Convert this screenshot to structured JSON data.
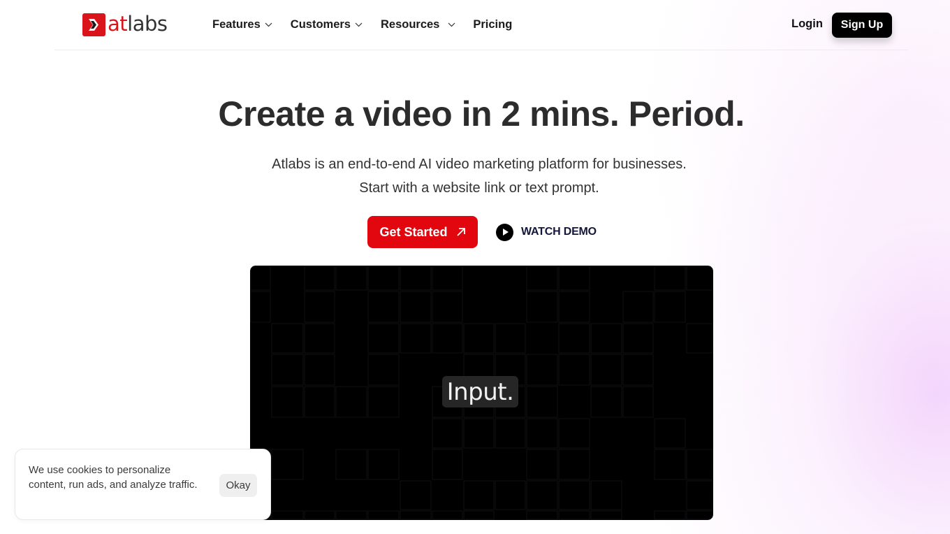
{
  "header": {
    "logo": {
      "accent_part": "at",
      "rest_part": "labs",
      "brand_color": "#d9141b"
    },
    "nav": [
      {
        "label": "Features",
        "has_dropdown": true
      },
      {
        "label": "Customers",
        "has_dropdown": true
      },
      {
        "label": "Resources",
        "has_dropdown": true
      },
      {
        "label": "Pricing",
        "has_dropdown": false
      }
    ],
    "login_label": "Login",
    "signup_label": "Sign Up"
  },
  "hero": {
    "title": "Create a video in 2 mins. Period.",
    "subtitle_line1": "Atlabs is an end-to-end AI video marketing platform for businesses.",
    "subtitle_line2": "Start with a website link or text prompt.",
    "primary_cta": {
      "label": "Get Started",
      "icon": "arrow-up-right-icon",
      "color": "#e2070f"
    },
    "secondary_cta": {
      "label": "WATCH DEMO",
      "icon": "play-icon"
    }
  },
  "video": {
    "caption": "Input."
  },
  "cookie_banner": {
    "text": "We use cookies to personalize content, run ads, and analyze traffic.",
    "button_label": "Okay"
  }
}
